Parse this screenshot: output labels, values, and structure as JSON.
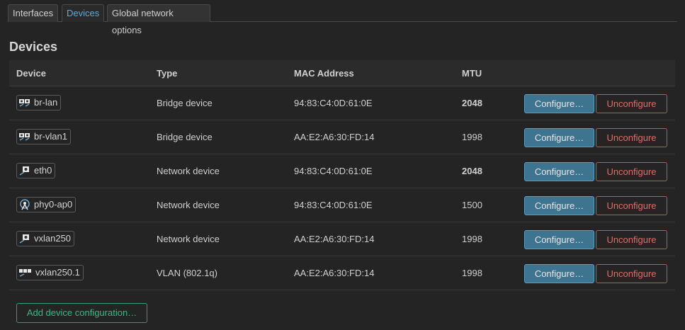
{
  "tabs": [
    {
      "label": "Interfaces",
      "active": false
    },
    {
      "label": "Devices",
      "active": true
    },
    {
      "label": "Global network options",
      "active": false
    }
  ],
  "section_title": "Devices",
  "table": {
    "headers": [
      "Device",
      "Type",
      "MAC Address",
      "MTU"
    ],
    "rows": [
      {
        "device": "br-lan",
        "icon": "bridge-icon",
        "type": "Bridge device",
        "mac": "94:83:C4:0D:61:0E",
        "mtu": "2048",
        "mtu_bold": true
      },
      {
        "device": "br-vlan1",
        "icon": "bridge-icon",
        "type": "Bridge device",
        "mac": "AA:E2:A6:30:FD:14",
        "mtu": "1998",
        "mtu_bold": false
      },
      {
        "device": "eth0",
        "icon": "ethernet-icon",
        "type": "Network device",
        "mac": "94:83:C4:0D:61:0E",
        "mtu": "2048",
        "mtu_bold": true
      },
      {
        "device": "phy0-ap0",
        "icon": "wifi-icon",
        "type": "Network device",
        "mac": "94:83:C4:0D:61:0E",
        "mtu": "1500",
        "mtu_bold": false
      },
      {
        "device": "vxlan250",
        "icon": "tunnel-icon",
        "type": "Network device",
        "mac": "AA:E2:A6:30:FD:14",
        "mtu": "1998",
        "mtu_bold": false
      },
      {
        "device": "vxlan250.1",
        "icon": "vlan-icon",
        "type": "VLAN (802.1q)",
        "mac": "AA:E2:A6:30:FD:14",
        "mtu": "1998",
        "mtu_bold": false
      }
    ],
    "configure_label": "Configure…",
    "unconfigure_label": "Unconfigure"
  },
  "add_button_label": "Add device configuration…",
  "colors": {
    "background": "#242424",
    "accent_blue": "#3d7490",
    "danger_red": "#c95353",
    "success_green": "#2f9e70",
    "active_tab_text": "#6aa7cf"
  }
}
